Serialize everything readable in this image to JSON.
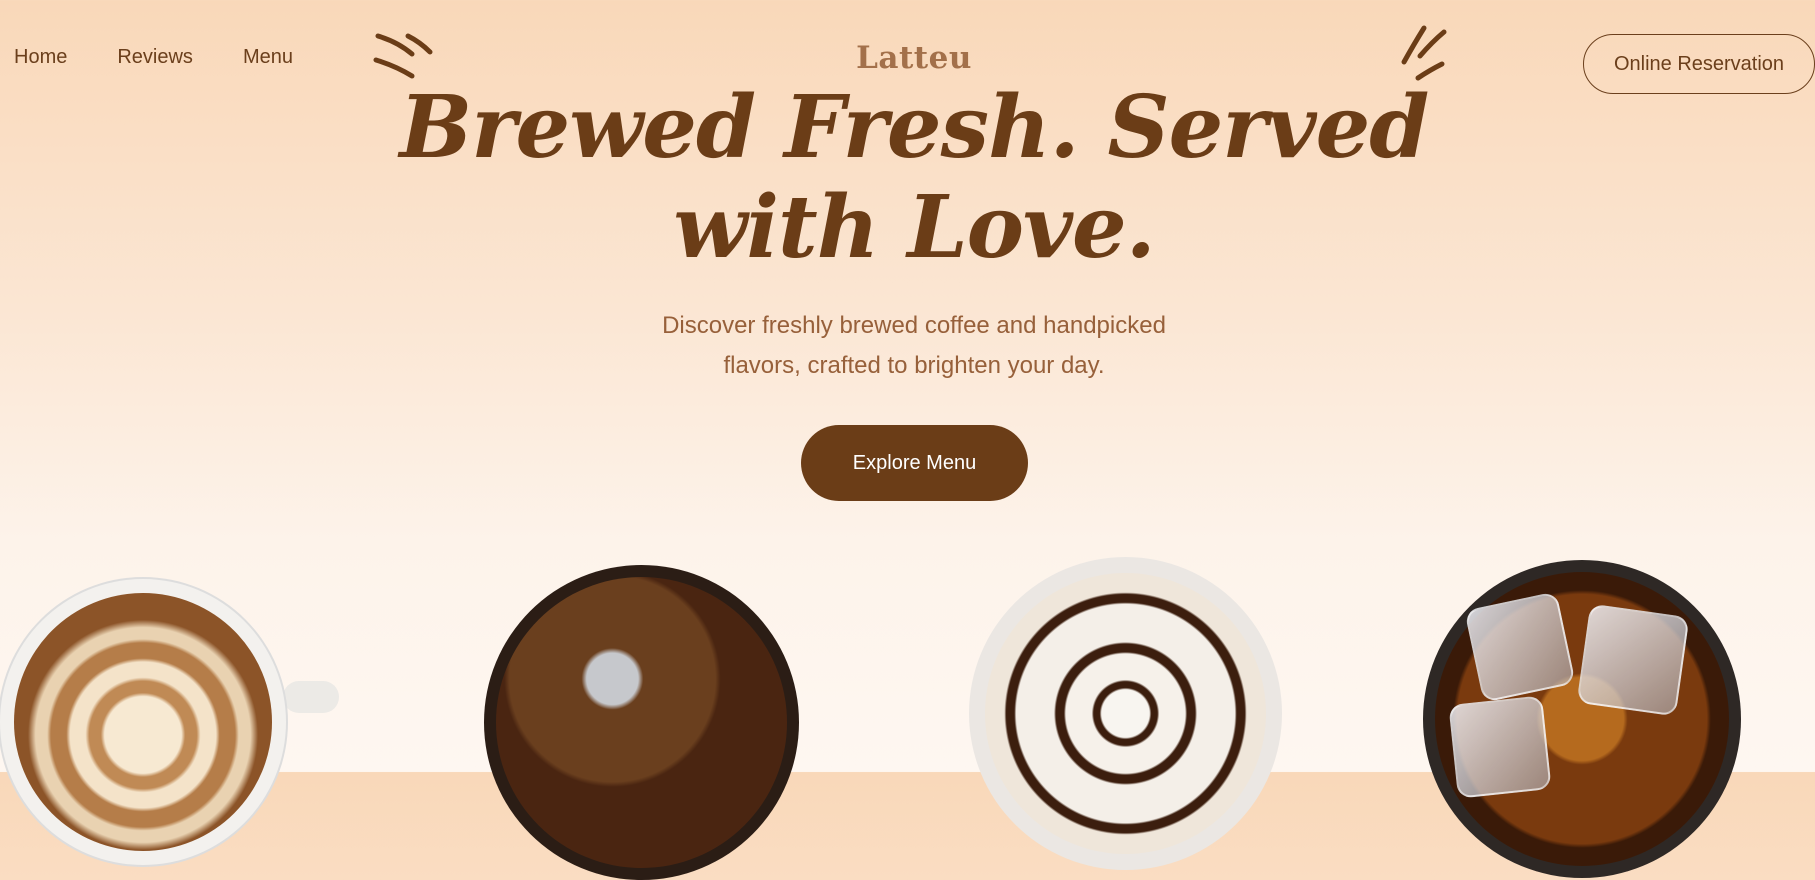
{
  "nav": {
    "items": [
      "Home",
      "Reviews",
      "Menu"
    ]
  },
  "brand": "Latteu",
  "reserve_label": "Online Reservation",
  "hero": {
    "headline_line1": "Brewed Fresh. Served",
    "headline_line2": "with Love.",
    "sub_line1": "Discover freshly brewed coffee and handpicked",
    "sub_line2": "flavors, crafted to brighten your day.",
    "cta_label": "Explore Menu"
  },
  "colors": {
    "primary": "#6b3d17",
    "brand": "#a3704a",
    "subtext": "#97603a"
  }
}
